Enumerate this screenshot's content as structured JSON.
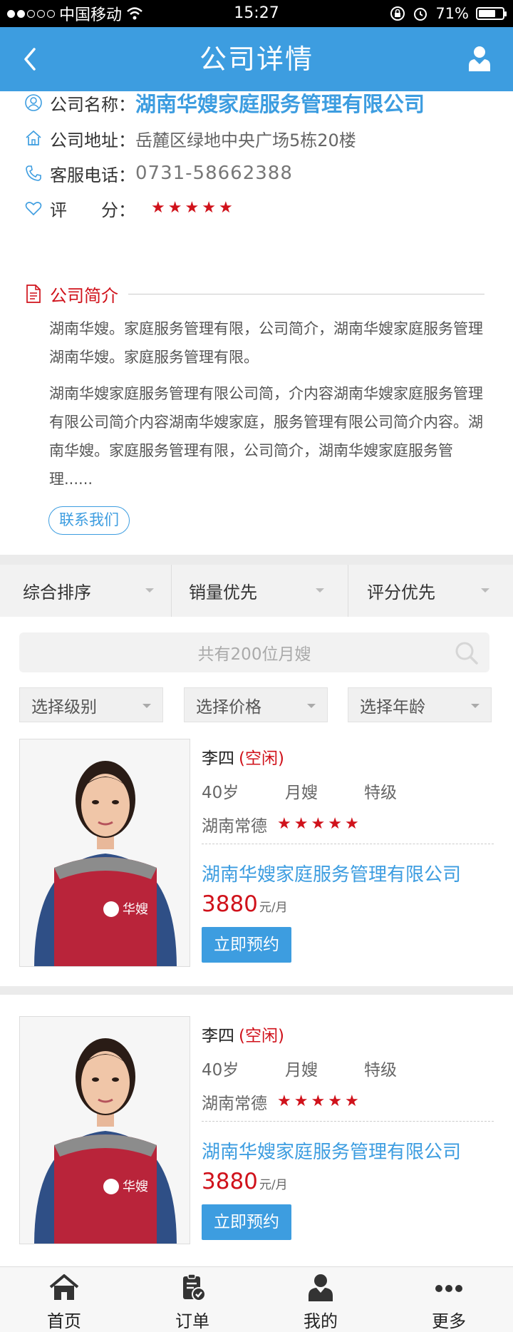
{
  "status_bar": {
    "carrier": "中国移动",
    "time": "15:27",
    "battery": "71%",
    "battery_level": 0.71
  },
  "nav": {
    "title": "公司详情"
  },
  "company": {
    "name_label": "公司名称：",
    "name": "湖南华嫂家庭服务管理有限公司",
    "address_label": "公司地址：",
    "address": "岳麓区绿地中央广场5栋20楼",
    "phone_label": "客服电话：",
    "phone": "0731-58662388",
    "rating_label": "评　　分：",
    "rating": 5,
    "intro_title": "公司简介",
    "intro_p1": "湖南华嫂。家庭服务管理有限，公司简介，湖南华嫂家庭服务管理湖南华嫂。家庭服务管理有限。",
    "intro_p2": "湖南华嫂家庭服务管理有限公司简，介内容湖南华嫂家庭服务管理有限公司简介内容湖南华嫂家庭，服务管理有限公司简介内容。湖南华嫂。家庭服务管理有限，公司简介，湖南华嫂家庭服务管理......",
    "contact_button": "联系我们"
  },
  "sort": {
    "items": [
      "综合排序",
      "销量优先",
      "评分优先"
    ]
  },
  "search": {
    "placeholder": "共有200位月嫂"
  },
  "filters": [
    "选择级别",
    "选择价格",
    "选择年龄"
  ],
  "nannies": [
    {
      "name": "李四",
      "status": "(空闲)",
      "age": "40岁",
      "role": "月嫂",
      "level": "特级",
      "location": "湖南常德",
      "rating": 5,
      "company": "湖南华嫂家庭服务管理有限公司",
      "price": "3880",
      "unit": "元/月",
      "book_label": "立即预约",
      "apron_logo": "华嫂"
    },
    {
      "name": "李四",
      "status": "(空闲)",
      "age": "40岁",
      "role": "月嫂",
      "level": "特级",
      "location": "湖南常德",
      "rating": 5,
      "company": "湖南华嫂家庭服务管理有限公司",
      "price": "3880",
      "unit": "元/月",
      "book_label": "立即预约",
      "apron_logo": "华嫂"
    }
  ],
  "tabs": [
    {
      "label": "首页",
      "icon": "home-icon"
    },
    {
      "label": "订单",
      "icon": "order-icon"
    },
    {
      "label": "我的",
      "icon": "user-icon"
    },
    {
      "label": "更多",
      "icon": "more-icon"
    }
  ],
  "colors": {
    "primary": "#3d9de0",
    "accent_red": "#d0121b"
  }
}
